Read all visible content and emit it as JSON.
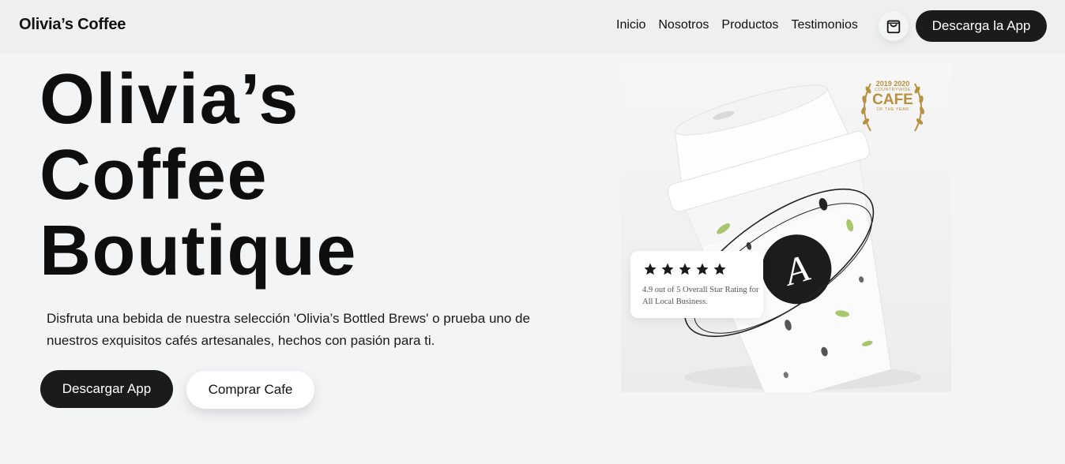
{
  "nav": {
    "brand": "Olivia’s Coffee",
    "links": [
      "Inicio",
      "Nosotros",
      "Productos",
      "Testimonios"
    ],
    "cart_icon": "shopping-bag-icon",
    "cta": "Descarga la App"
  },
  "hero": {
    "title_lines": [
      "Olivia’s",
      "Coffee",
      "Boutique"
    ],
    "description": "Disfruta una bebida de nuestra selección 'Olivia’s Bottled Brews' o prueba uno de nuestros exquisitos cafés artesanales, hechos con pasión para ti.",
    "primary_button": "Descargar App",
    "secondary_button": "Comprar Cafe"
  },
  "image_card": {
    "award": {
      "years": "2019 2020",
      "line": "COUNTRYWIDE",
      "title": "CAFE",
      "subtitle": "OF THE YEAR"
    },
    "cup_logo_letter": "A",
    "rating": {
      "stars": 5,
      "text": "4.9 out of 5 Overall Star Rating for All Local Business."
    }
  },
  "colors": {
    "background": "#f3f4f6",
    "navbar": "#efeff0",
    "dark_button": "#1b1b1d",
    "award_gold": "#b8903f",
    "leaf_green": "#a8c66c"
  }
}
